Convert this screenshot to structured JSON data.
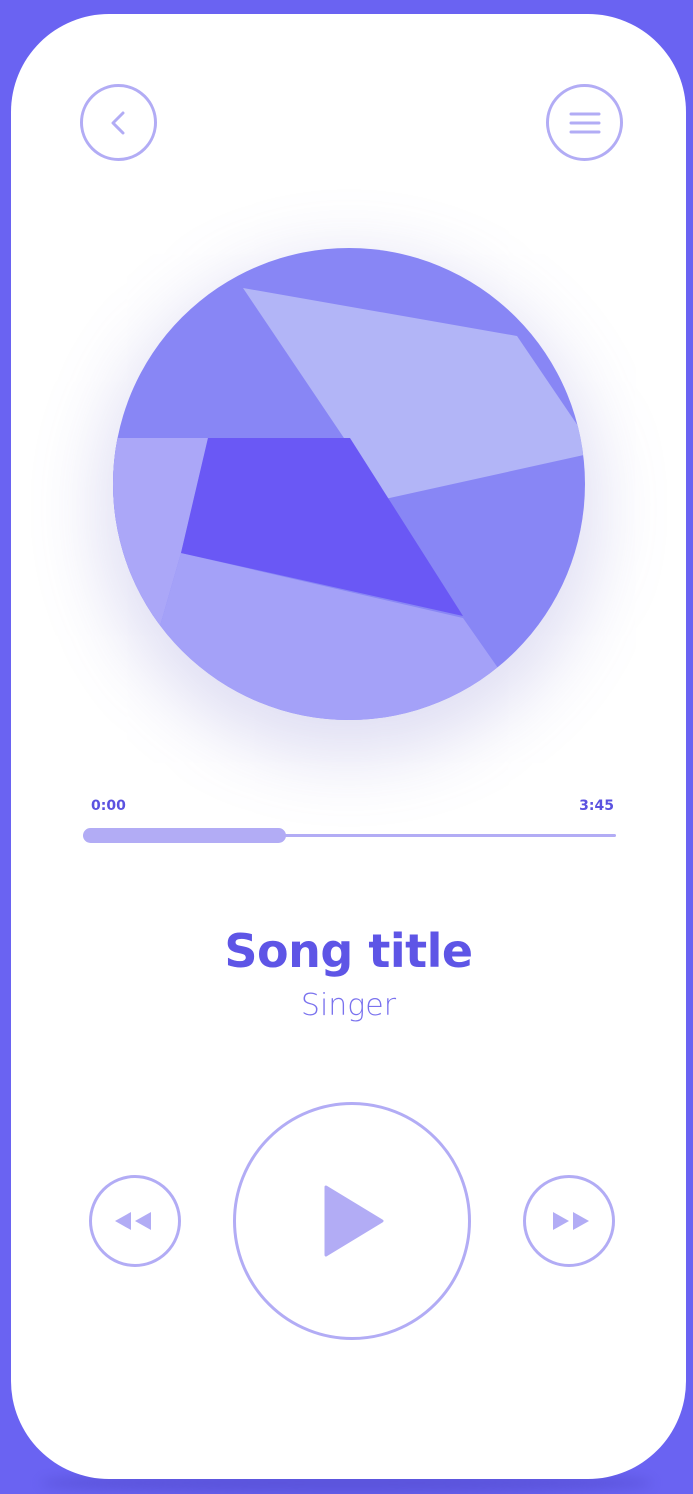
{
  "player": {
    "elapsed_time": "0:00",
    "total_time": "3:45",
    "progress": 0.38,
    "song_title": "Song title",
    "singer": "Singer"
  },
  "icons": {
    "back": "chevron-left-icon",
    "menu": "hamburger-menu-icon",
    "rewind": "rewind-icon",
    "play": "play-icon",
    "fast_forward": "fast-forward-icon"
  },
  "colors": {
    "background": "#6a63f2",
    "card": "#ffffff",
    "accent": "#5e55e6",
    "outline": "#b2acf5",
    "art_dark": "#6a58f5",
    "art_mid": "#8886f5",
    "art_light": "#b2b5f7",
    "art_soft": "#a4a1f8"
  }
}
